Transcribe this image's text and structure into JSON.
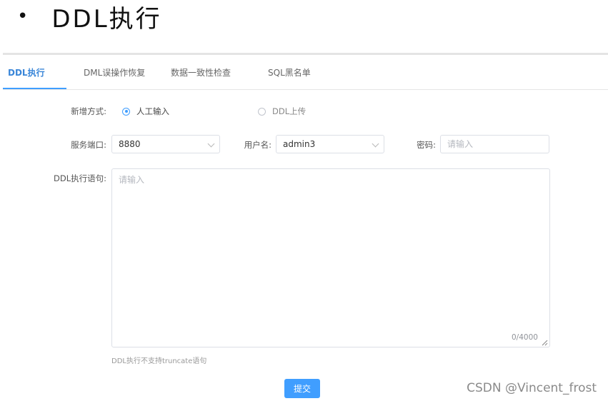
{
  "slide": {
    "bullet": "•",
    "title": "DDL执行"
  },
  "tabs": [
    {
      "label": "DDL执行",
      "active": true
    },
    {
      "label": "DML误操作恢复",
      "active": false
    },
    {
      "label": "数据一致性检查",
      "active": false
    },
    {
      "label": "SQL黑名单",
      "active": false
    }
  ],
  "form": {
    "add_mode_label": "新增方式:",
    "add_mode_options": [
      "人工输入",
      "DDL上传"
    ],
    "add_mode_selected": "人工输入",
    "port_label": "服务端口:",
    "port_value": "8880",
    "username_label": "用户名:",
    "username_value": "admin3",
    "password_label": "密码:",
    "password_placeholder": "请输入",
    "statement_label": "DDL执行语句:",
    "statement_placeholder": "请输入",
    "statement_counter": "0/4000",
    "tip": "DDL执行不支持truncate语句",
    "submit_label": "提交"
  },
  "watermark": "CSDN @Vincent_frost",
  "colors": {
    "accent": "#409eff",
    "active_tab": "#3a86d8"
  }
}
